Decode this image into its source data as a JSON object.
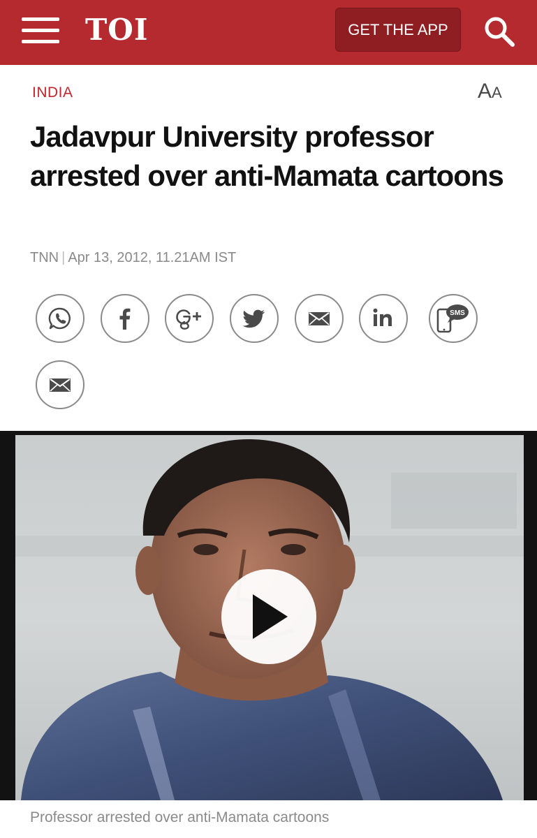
{
  "header": {
    "logo": "TOI",
    "app_button_label": "GET THE APP",
    "menu_icon": "hamburger-menu-icon",
    "search_icon": "search-icon",
    "bar_color": "#b52a2e"
  },
  "article": {
    "section": "INDIA",
    "font_control": {
      "large": "A",
      "small": "A"
    },
    "headline": "Jadavpur University professor arrested over anti-Mamata cartoons",
    "byline": {
      "source": "TNN",
      "separator": "|",
      "date": "Apr 13, 2012, 11.21AM IST"
    }
  },
  "share": {
    "icons": [
      "whatsapp-icon",
      "facebook-icon",
      "google-plus-icon",
      "twitter-icon",
      "email-icon",
      "linkedin-icon",
      "sms-icon",
      "email-icon"
    ],
    "sms_label": "SMS"
  },
  "video": {
    "caption": "Professor arrested over anti-Mamata cartoons",
    "play_icon": "play-icon"
  }
}
